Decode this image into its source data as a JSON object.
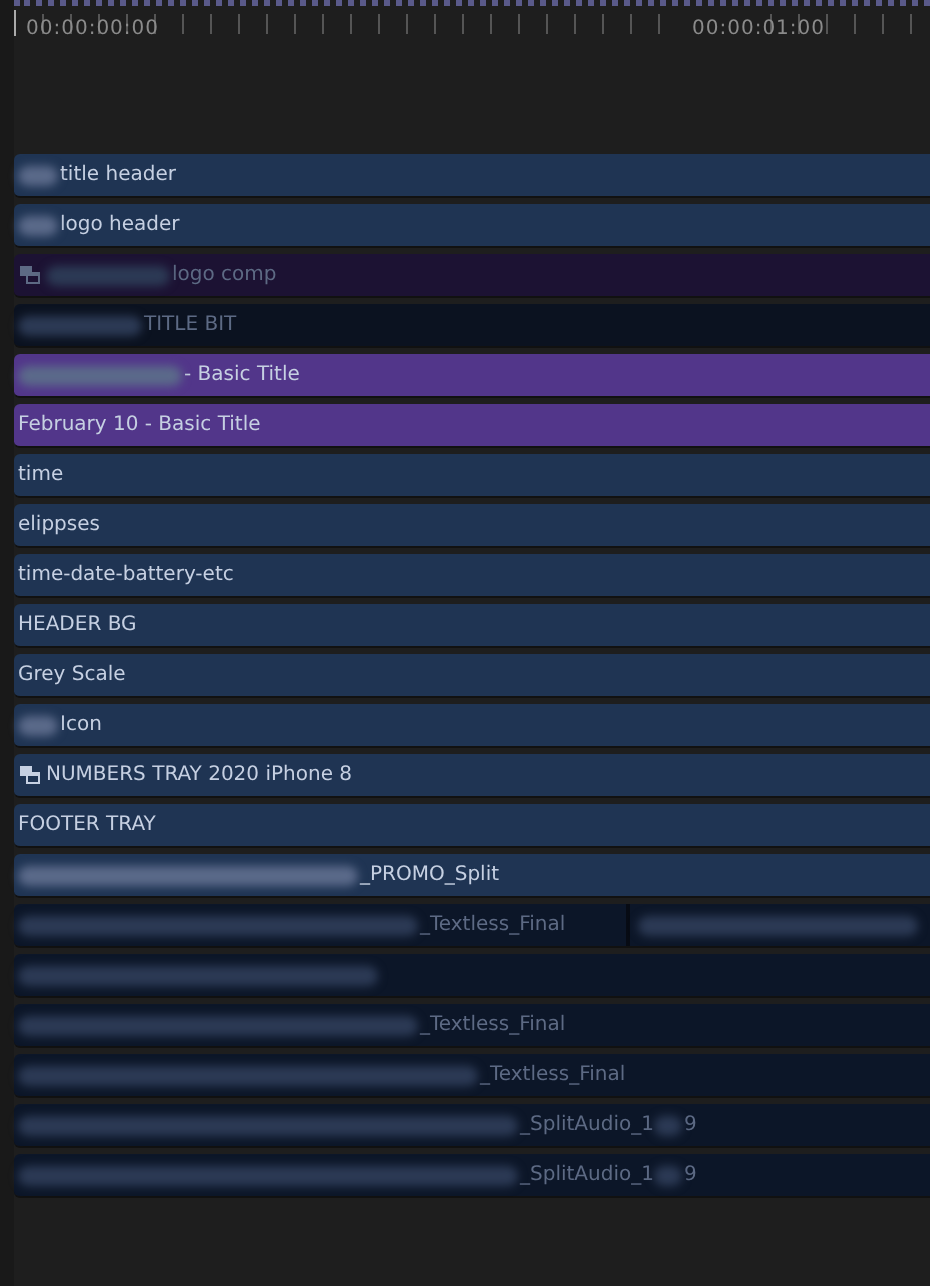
{
  "ruler": {
    "timecodes": [
      "00:00:00:00",
      "00:00:01:00"
    ]
  },
  "layers": [
    {
      "label": "title header",
      "color": "#1f3453",
      "dimmed": false,
      "precomp": false,
      "redacted": true
    },
    {
      "label": "logo header",
      "color": "#1f3453",
      "dimmed": false,
      "precomp": false,
      "redacted": true
    },
    {
      "label": "logo comp",
      "color": "#1c1233",
      "dimmed": true,
      "precomp": true,
      "redacted": true
    },
    {
      "label": "TITLE BIT",
      "color": "#0b1220",
      "dimmed": true,
      "precomp": false,
      "redacted": true
    },
    {
      "label": "- Basic Title",
      "color": "#52368a",
      "dimmed": false,
      "precomp": false,
      "redacted": true
    },
    {
      "label": "February 10 - Basic Title",
      "color": "#52368a",
      "dimmed": false,
      "precomp": false
    },
    {
      "label": "time",
      "color": "#1f3453",
      "dimmed": false,
      "precomp": false
    },
    {
      "label": "elippses",
      "color": "#1f3453",
      "dimmed": false,
      "precomp": false
    },
    {
      "label": "time-date-battery-etc",
      "color": "#1f3453",
      "dimmed": false,
      "precomp": false
    },
    {
      "label": "HEADER BG",
      "color": "#1f3453",
      "dimmed": false,
      "precomp": false
    },
    {
      "label": "Grey Scale",
      "color": "#1f3453",
      "dimmed": false,
      "precomp": false
    },
    {
      "label": "Icon",
      "color": "#1f3453",
      "dimmed": false,
      "precomp": false,
      "redacted": true
    },
    {
      "label": "NUMBERS TRAY 2020 iPhone 8",
      "color": "#1f3453",
      "dimmed": false,
      "precomp": true
    },
    {
      "label": "FOOTER TRAY",
      "color": "#1f3453",
      "dimmed": false,
      "precomp": false
    },
    {
      "label": "_PROMO_Split",
      "color": "#1f3453",
      "dimmed": false,
      "precomp": false,
      "redacted": true
    },
    {
      "label": "_Textless_Final",
      "color": "#0c1628",
      "dimmed": true,
      "precomp": false,
      "redacted": true,
      "second_clip": true
    },
    {
      "color": "#0c1628",
      "dimmed": true,
      "precomp": false,
      "redacted": true
    },
    {
      "label": "_Textless_Final",
      "color": "#0c1628",
      "dimmed": true,
      "precomp": false,
      "redacted": true
    },
    {
      "label": "_Textless_Final",
      "color": "#0c1628",
      "dimmed": true,
      "precomp": false,
      "redacted": true
    },
    {
      "label": "_SplitAudio_1",
      "label_end": "9",
      "color": "#0c1628",
      "dimmed": true,
      "precomp": false,
      "redacted": true
    },
    {
      "label": "_SplitAudio_1",
      "label_end": "9",
      "color": "#0c1628",
      "dimmed": true,
      "precomp": false,
      "redacted": true
    }
  ]
}
